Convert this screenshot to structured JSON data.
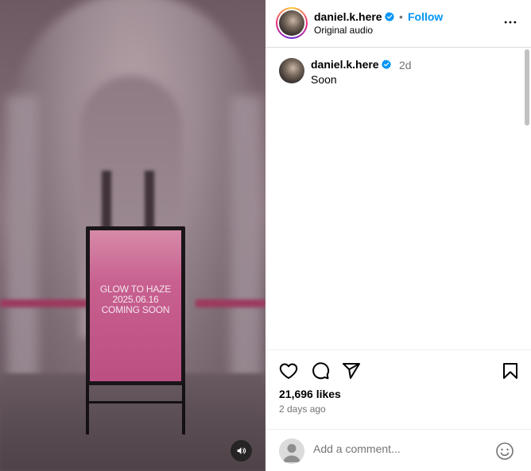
{
  "media": {
    "sign_line1": "GLOW TO HAZE",
    "sign_line2": "2025.06.16",
    "sign_line3": "COMING SOON",
    "sound_icon": "speaker-icon"
  },
  "header": {
    "username": "daniel.k.here",
    "separator": "•",
    "follow_label": "Follow",
    "subtitle": "Original audio",
    "more_icon": "more-horizontal-icon"
  },
  "comment": {
    "username": "daniel.k.here",
    "time": "2d",
    "text": "Soon"
  },
  "actions": {
    "like_icon": "heart-icon",
    "comment_icon": "comment-icon",
    "share_icon": "share-icon",
    "save_icon": "bookmark-icon",
    "likes": "21,696 likes",
    "posted_ago": "2 days ago"
  },
  "comment_box": {
    "placeholder": "Add a comment...",
    "emoji_icon": "emoji-icon"
  },
  "colors": {
    "follow_blue": "#0095f6",
    "verified_blue": "#0095f6",
    "muted": "#737373",
    "sign_pink": "#c8608f"
  }
}
